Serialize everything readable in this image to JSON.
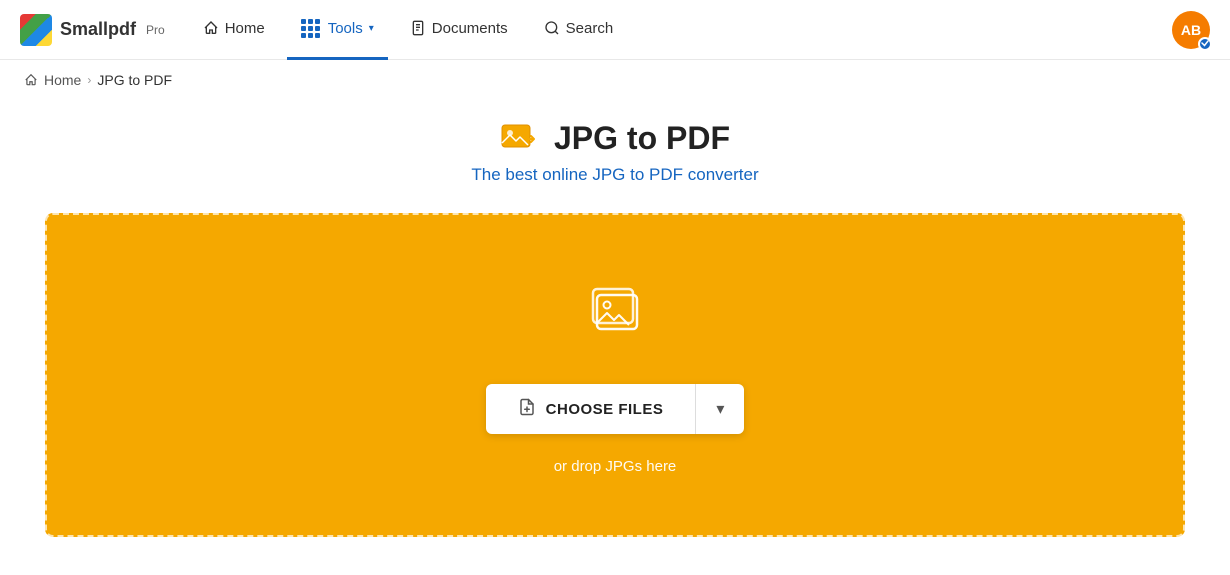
{
  "brand": {
    "name": "Smallpdf",
    "pro": "Pro"
  },
  "nav": {
    "home_label": "Home",
    "tools_label": "Tools",
    "documents_label": "Documents",
    "search_label": "Search",
    "avatar_initials": "AB"
  },
  "breadcrumb": {
    "home": "Home",
    "separator": "›",
    "current": "JPG to PDF"
  },
  "main": {
    "title": "JPG to PDF",
    "subtitle": "The best online JPG to PDF converter",
    "choose_files_label": "CHOOSE FILES",
    "drop_hint": "or drop JPGs here"
  }
}
